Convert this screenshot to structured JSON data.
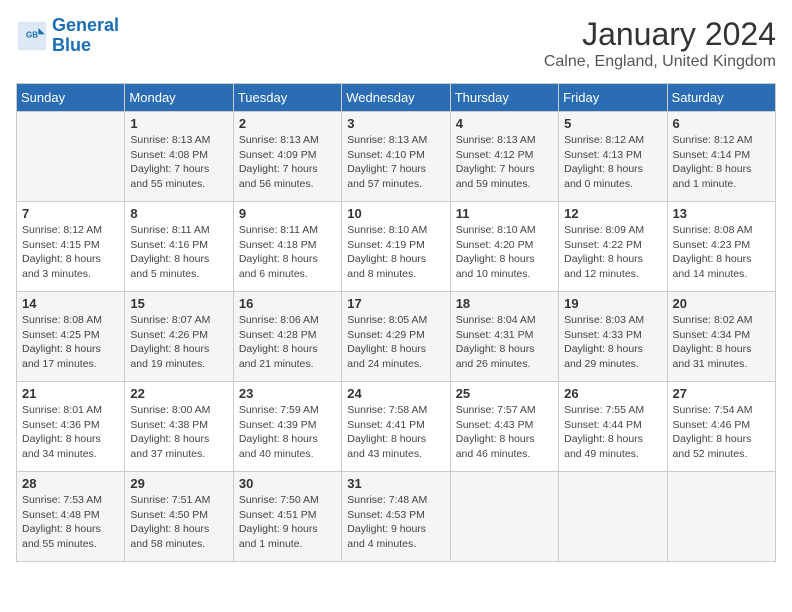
{
  "logo": {
    "line1": "General",
    "line2": "Blue"
  },
  "title": "January 2024",
  "location": "Calne, England, United Kingdom",
  "weekdays": [
    "Sunday",
    "Monday",
    "Tuesday",
    "Wednesday",
    "Thursday",
    "Friday",
    "Saturday"
  ],
  "rows": [
    [
      {
        "day": "",
        "sunrise": "",
        "sunset": "",
        "daylight": ""
      },
      {
        "day": "1",
        "sunrise": "Sunrise: 8:13 AM",
        "sunset": "Sunset: 4:08 PM",
        "daylight": "Daylight: 7 hours and 55 minutes."
      },
      {
        "day": "2",
        "sunrise": "Sunrise: 8:13 AM",
        "sunset": "Sunset: 4:09 PM",
        "daylight": "Daylight: 7 hours and 56 minutes."
      },
      {
        "day": "3",
        "sunrise": "Sunrise: 8:13 AM",
        "sunset": "Sunset: 4:10 PM",
        "daylight": "Daylight: 7 hours and 57 minutes."
      },
      {
        "day": "4",
        "sunrise": "Sunrise: 8:13 AM",
        "sunset": "Sunset: 4:12 PM",
        "daylight": "Daylight: 7 hours and 59 minutes."
      },
      {
        "day": "5",
        "sunrise": "Sunrise: 8:12 AM",
        "sunset": "Sunset: 4:13 PM",
        "daylight": "Daylight: 8 hours and 0 minutes."
      },
      {
        "day": "6",
        "sunrise": "Sunrise: 8:12 AM",
        "sunset": "Sunset: 4:14 PM",
        "daylight": "Daylight: 8 hours and 1 minute."
      }
    ],
    [
      {
        "day": "7",
        "sunrise": "Sunrise: 8:12 AM",
        "sunset": "Sunset: 4:15 PM",
        "daylight": "Daylight: 8 hours and 3 minutes."
      },
      {
        "day": "8",
        "sunrise": "Sunrise: 8:11 AM",
        "sunset": "Sunset: 4:16 PM",
        "daylight": "Daylight: 8 hours and 5 minutes."
      },
      {
        "day": "9",
        "sunrise": "Sunrise: 8:11 AM",
        "sunset": "Sunset: 4:18 PM",
        "daylight": "Daylight: 8 hours and 6 minutes."
      },
      {
        "day": "10",
        "sunrise": "Sunrise: 8:10 AM",
        "sunset": "Sunset: 4:19 PM",
        "daylight": "Daylight: 8 hours and 8 minutes."
      },
      {
        "day": "11",
        "sunrise": "Sunrise: 8:10 AM",
        "sunset": "Sunset: 4:20 PM",
        "daylight": "Daylight: 8 hours and 10 minutes."
      },
      {
        "day": "12",
        "sunrise": "Sunrise: 8:09 AM",
        "sunset": "Sunset: 4:22 PM",
        "daylight": "Daylight: 8 hours and 12 minutes."
      },
      {
        "day": "13",
        "sunrise": "Sunrise: 8:08 AM",
        "sunset": "Sunset: 4:23 PM",
        "daylight": "Daylight: 8 hours and 14 minutes."
      }
    ],
    [
      {
        "day": "14",
        "sunrise": "Sunrise: 8:08 AM",
        "sunset": "Sunset: 4:25 PM",
        "daylight": "Daylight: 8 hours and 17 minutes."
      },
      {
        "day": "15",
        "sunrise": "Sunrise: 8:07 AM",
        "sunset": "Sunset: 4:26 PM",
        "daylight": "Daylight: 8 hours and 19 minutes."
      },
      {
        "day": "16",
        "sunrise": "Sunrise: 8:06 AM",
        "sunset": "Sunset: 4:28 PM",
        "daylight": "Daylight: 8 hours and 21 minutes."
      },
      {
        "day": "17",
        "sunrise": "Sunrise: 8:05 AM",
        "sunset": "Sunset: 4:29 PM",
        "daylight": "Daylight: 8 hours and 24 minutes."
      },
      {
        "day": "18",
        "sunrise": "Sunrise: 8:04 AM",
        "sunset": "Sunset: 4:31 PM",
        "daylight": "Daylight: 8 hours and 26 minutes."
      },
      {
        "day": "19",
        "sunrise": "Sunrise: 8:03 AM",
        "sunset": "Sunset: 4:33 PM",
        "daylight": "Daylight: 8 hours and 29 minutes."
      },
      {
        "day": "20",
        "sunrise": "Sunrise: 8:02 AM",
        "sunset": "Sunset: 4:34 PM",
        "daylight": "Daylight: 8 hours and 31 minutes."
      }
    ],
    [
      {
        "day": "21",
        "sunrise": "Sunrise: 8:01 AM",
        "sunset": "Sunset: 4:36 PM",
        "daylight": "Daylight: 8 hours and 34 minutes."
      },
      {
        "day": "22",
        "sunrise": "Sunrise: 8:00 AM",
        "sunset": "Sunset: 4:38 PM",
        "daylight": "Daylight: 8 hours and 37 minutes."
      },
      {
        "day": "23",
        "sunrise": "Sunrise: 7:59 AM",
        "sunset": "Sunset: 4:39 PM",
        "daylight": "Daylight: 8 hours and 40 minutes."
      },
      {
        "day": "24",
        "sunrise": "Sunrise: 7:58 AM",
        "sunset": "Sunset: 4:41 PM",
        "daylight": "Daylight: 8 hours and 43 minutes."
      },
      {
        "day": "25",
        "sunrise": "Sunrise: 7:57 AM",
        "sunset": "Sunset: 4:43 PM",
        "daylight": "Daylight: 8 hours and 46 minutes."
      },
      {
        "day": "26",
        "sunrise": "Sunrise: 7:55 AM",
        "sunset": "Sunset: 4:44 PM",
        "daylight": "Daylight: 8 hours and 49 minutes."
      },
      {
        "day": "27",
        "sunrise": "Sunrise: 7:54 AM",
        "sunset": "Sunset: 4:46 PM",
        "daylight": "Daylight: 8 hours and 52 minutes."
      }
    ],
    [
      {
        "day": "28",
        "sunrise": "Sunrise: 7:53 AM",
        "sunset": "Sunset: 4:48 PM",
        "daylight": "Daylight: 8 hours and 55 minutes."
      },
      {
        "day": "29",
        "sunrise": "Sunrise: 7:51 AM",
        "sunset": "Sunset: 4:50 PM",
        "daylight": "Daylight: 8 hours and 58 minutes."
      },
      {
        "day": "30",
        "sunrise": "Sunrise: 7:50 AM",
        "sunset": "Sunset: 4:51 PM",
        "daylight": "Daylight: 9 hours and 1 minute."
      },
      {
        "day": "31",
        "sunrise": "Sunrise: 7:48 AM",
        "sunset": "Sunset: 4:53 PM",
        "daylight": "Daylight: 9 hours and 4 minutes."
      },
      {
        "day": "",
        "sunrise": "",
        "sunset": "",
        "daylight": ""
      },
      {
        "day": "",
        "sunrise": "",
        "sunset": "",
        "daylight": ""
      },
      {
        "day": "",
        "sunrise": "",
        "sunset": "",
        "daylight": ""
      }
    ]
  ]
}
